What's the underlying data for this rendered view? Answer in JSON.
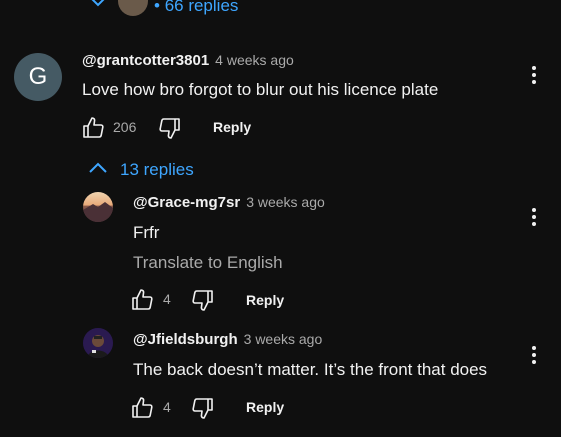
{
  "top": {
    "replies_label": "66 replies"
  },
  "comment": {
    "avatar_letter": "G",
    "handle": "@grantcotter3801",
    "time": "4 weeks ago",
    "text": "Love how bro forgot to blur out his licence plate",
    "likes": "206",
    "reply_label": "Reply",
    "replies_toggle": "13 replies"
  },
  "replies": [
    {
      "handle": "@Grace-mg7sr",
      "time": "3 weeks ago",
      "text": "Frfr",
      "translate": "Translate to English",
      "likes": "4",
      "reply_label": "Reply"
    },
    {
      "handle": "@Jfieldsburgh",
      "time": "3 weeks ago",
      "text": "The back doesn’t matter. It’s the front that does",
      "likes": "4",
      "reply_label": "Reply"
    }
  ],
  "colors": {
    "accent": "#3ea6ff",
    "background": "#0f0f0f",
    "avatar_g": "#455a64"
  }
}
